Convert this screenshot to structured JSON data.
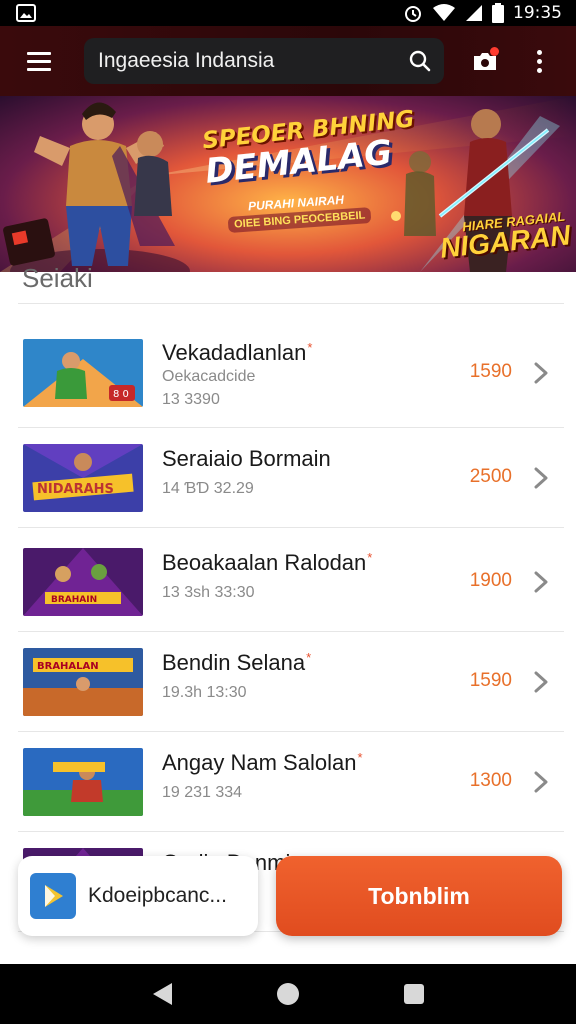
{
  "status": {
    "time": "19:35",
    "icons": [
      "image-icon",
      "alarm-icon",
      "wifi-icon",
      "signal-icon",
      "battery-icon"
    ]
  },
  "app_bar": {
    "search_text": "Ingaeesia Indansia",
    "icons": [
      "menu-icon",
      "search-icon",
      "camera-icon",
      "more-vert-icon"
    ]
  },
  "banner": {
    "title_1": "SPEOER BHNING",
    "title_2": "DEMALAG",
    "sub_1": "PURAHI NAIRAH",
    "sub_2": "OIEE BING PEOCEBBEIL",
    "tag_1": "HIARE RAGAIAL",
    "tag_2": "NIGARAN"
  },
  "section_title": "Seiaki",
  "items": [
    {
      "title": "Vekadadlanlan",
      "starred": true,
      "sub1": "Oekacadcide",
      "sub2": "13 3390",
      "price": "1590",
      "thumb": "hero"
    },
    {
      "title": "Seraiaio Bormain",
      "starred": false,
      "sub1": "",
      "sub2": "14 ƁƊ 32.29",
      "price": "2500",
      "thumb": "arena"
    },
    {
      "title": "Beoakaalan Ralodan",
      "starred": true,
      "sub1": "",
      "sub2": "13 3sh 33:30",
      "price": "1900",
      "thumb": "purple"
    },
    {
      "title": "Bendin Selana",
      "starred": true,
      "sub1": "",
      "sub2": "19.3h 13:30",
      "price": "1590",
      "thumb": "market"
    },
    {
      "title": "Angay Nam Salolan",
      "starred": true,
      "sub1": "",
      "sub2": "19 231 334",
      "price": "1300",
      "thumb": "green"
    },
    {
      "title": "Oorlin Danmin",
      "starred": false,
      "sub1": "",
      "sub2": "",
      "price": "",
      "thumb": "purple"
    }
  ],
  "install": {
    "label": "Kdoeipbcanc..."
  },
  "cta": {
    "label": "Tobnblim"
  },
  "colors": {
    "accent": "#e8502e",
    "price": "#e8702a",
    "appbar": "#2b0709"
  }
}
